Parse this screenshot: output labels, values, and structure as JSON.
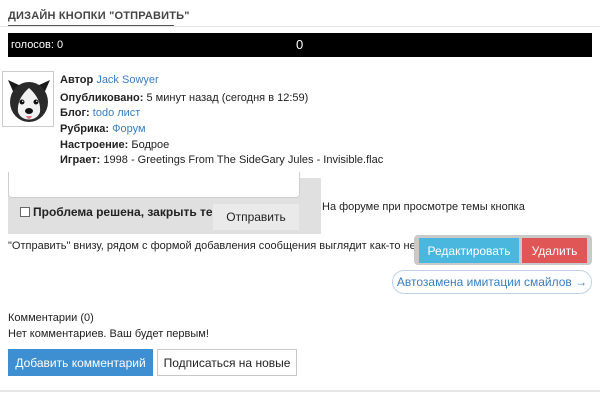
{
  "page": {
    "title": "ДИЗАЙН КНОПКИ \"ОТПРАВИТЬ\""
  },
  "vote": {
    "label": "голосов: 0",
    "count": "0"
  },
  "post_meta": {
    "author_label": "Автор",
    "author": "Jack Sowyer",
    "published_label": "Опубликовано:",
    "published": "5 минут назад (сегодня в 12:59)",
    "blog_label": "Блог:",
    "blog": "todo лист",
    "category_label": "Рубрика:",
    "category": "Форум",
    "mood_label": "Настроение:",
    "mood": "Бодрое",
    "playing_label": "Играет:",
    "playing": "1998 - Greetings From The SideGary Jules - Invisible.flac"
  },
  "form": {
    "checkbox_label": "Проблема решена, закрыть тему",
    "send_label": "Отправить"
  },
  "post_body": {
    "line1": "На форуме при просмотре темы кнопка",
    "line2": "\"Отправить\" внизу, рядом с формой добавления сообщения выглядит как-то некрасиво."
  },
  "actions": {
    "edit_label": "Редактировать",
    "delete_label": "Удалить"
  },
  "smiles": {
    "label": "Автозамена имитации смайлов →"
  },
  "comments": {
    "count_label": "Комментарии (0)",
    "empty_text": "Нет комментариев. Ваш будет первым!",
    "add_label": "Добавить комментарий",
    "subscribe_label": "Подписаться на новые"
  },
  "colors": {
    "vote_bar": "#000000",
    "link": "#3a7ec0",
    "edit_button": "#4ab8de",
    "delete_button": "#e05555",
    "add_comment_button": "#3d8fd1"
  }
}
